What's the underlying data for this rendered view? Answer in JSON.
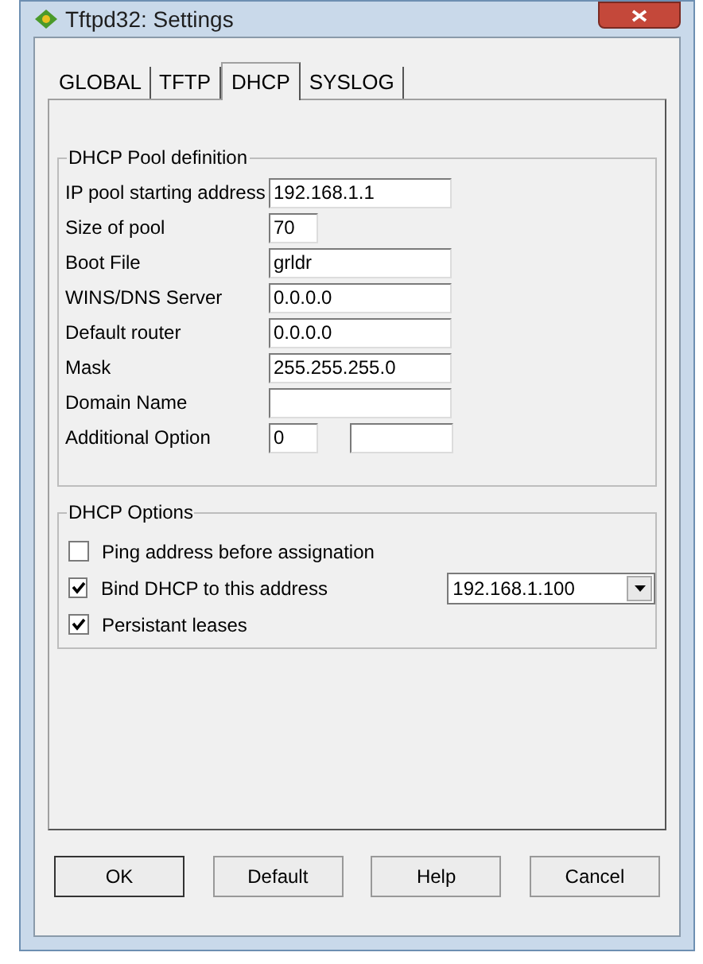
{
  "window": {
    "title": "Tftpd32: Settings"
  },
  "tabs": [
    {
      "label": "GLOBAL",
      "selected": false
    },
    {
      "label": "TFTP",
      "selected": false
    },
    {
      "label": "DHCP",
      "selected": true
    },
    {
      "label": "SYSLOG",
      "selected": false
    }
  ],
  "pool": {
    "title": "DHCP Pool definition",
    "fields": [
      {
        "label": "IP pool starting address",
        "kind": "wide",
        "value": "192.168.1.1"
      },
      {
        "label": "Size of pool",
        "kind": "narrow",
        "value": "70"
      },
      {
        "label": "Boot File",
        "kind": "wide",
        "value": "grldr"
      },
      {
        "label": "WINS/DNS Server",
        "kind": "wide",
        "value": "0.0.0.0"
      },
      {
        "label": "Default router",
        "kind": "wide",
        "value": "0.0.0.0"
      },
      {
        "label": "Mask",
        "kind": "wide",
        "value": "255.255.255.0"
      },
      {
        "label": "Domain Name",
        "kind": "wide"
      },
      {
        "label": "Additional Option",
        "kind": "pair",
        "value": "0"
      }
    ]
  },
  "options": {
    "title": "DHCP Options",
    "items": [
      {
        "label": "Ping address before assignation",
        "checked": false
      },
      {
        "label": "Bind DHCP to this address",
        "checked": true,
        "dropdown": "192.168.1.100"
      },
      {
        "label": "Persistant leases",
        "checked": true
      }
    ]
  },
  "buttons": [
    "OK",
    "Default",
    "Help",
    "Cancel"
  ]
}
